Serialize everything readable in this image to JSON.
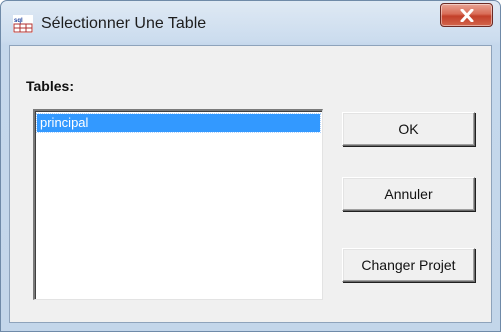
{
  "window": {
    "title": "Sélectionner Une Table",
    "icon": "sql-table-icon"
  },
  "dialog": {
    "tables_label": "Tables:",
    "tables": [
      "principal"
    ],
    "selected_index": 0
  },
  "buttons": {
    "ok": "OK",
    "cancel": "Annuler",
    "change_project": "Changer Projet"
  },
  "colors": {
    "selection": "#3399ff",
    "close_button": "#c3402a"
  }
}
